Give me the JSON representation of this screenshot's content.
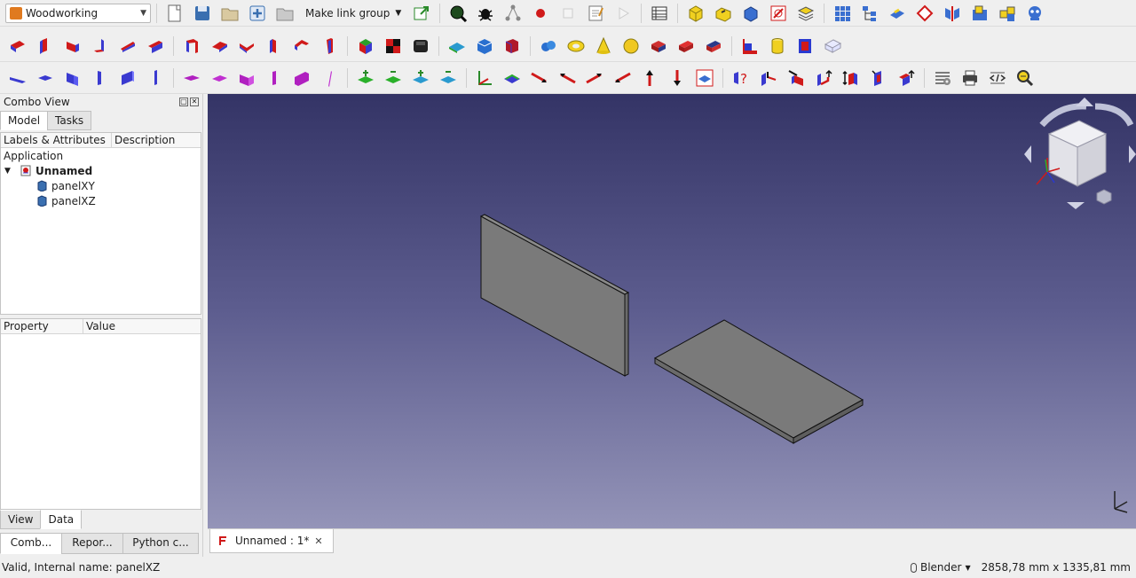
{
  "workbench": {
    "name": "Woodworking"
  },
  "toolbar": {
    "link_group_label": "Make link group"
  },
  "combo_view": {
    "title": "Combo View",
    "tabs": [
      "Model",
      "Tasks"
    ],
    "tree_headers": [
      "Labels & Attributes",
      "Description"
    ],
    "tree": {
      "root": "Application",
      "document": "Unnamed",
      "objects": [
        "panelXY",
        "panelXZ"
      ]
    },
    "property_headers": [
      "Property",
      "Value"
    ],
    "property_tabs": [
      "View",
      "Data"
    ],
    "bottom_tabs": [
      "Comb...",
      "Repor...",
      "Python c..."
    ]
  },
  "document_tab": {
    "label": "Unnamed : 1*"
  },
  "status": {
    "message": "Valid, Internal name: panelXZ",
    "nav_style": "Blender",
    "dimensions": "2858,78 mm x 1335,81 mm"
  },
  "colors": {
    "viewport_top": "#343466",
    "viewport_bottom": "#9494b8",
    "panel_face": "#7a7a7a",
    "accent_red": "#cc2222",
    "accent_blue": "#2244cc"
  }
}
